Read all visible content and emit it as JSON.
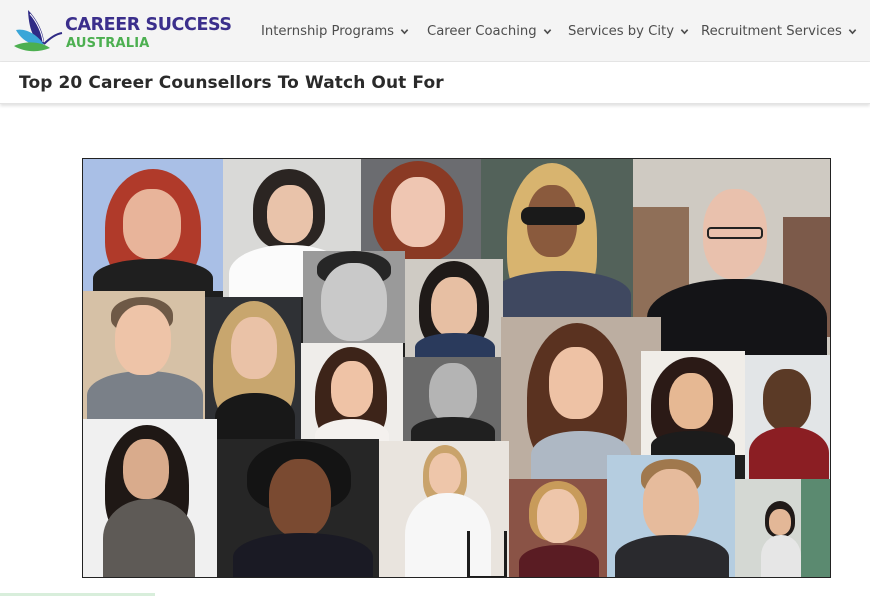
{
  "header": {
    "logo": {
      "line1": "CAREER SUCCESS",
      "line2": "AUSTRALIA",
      "icon": "butterfly-logo-icon",
      "colors": {
        "primary": "#3b2f8c",
        "accent": "#4caf50"
      }
    },
    "nav": [
      {
        "label": "Internship Programs",
        "icon": "chevron-down-icon"
      },
      {
        "label": "Career Coaching",
        "icon": "chevron-down-icon"
      },
      {
        "label": "Services by City",
        "icon": "chevron-down-icon"
      },
      {
        "label": "Recruitment Services",
        "icon": "chevron-down-icon"
      }
    ]
  },
  "page": {
    "title": "Top 20 Career Counsellors To Watch Out For"
  },
  "collage": {
    "photo_count": 20
  }
}
